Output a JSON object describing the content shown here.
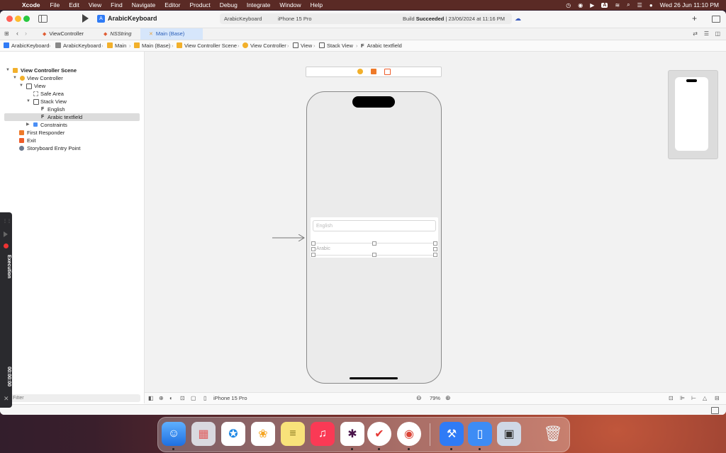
{
  "menubar": {
    "app_name": "Xcode",
    "items": [
      "File",
      "Edit",
      "View",
      "Find",
      "Navigate",
      "Editor",
      "Product",
      "Debug",
      "Integrate",
      "Window",
      "Help"
    ],
    "input_source": "A",
    "clock": "Wed 26 Jun  11:10 PM"
  },
  "toolbar": {
    "project_title": "ArabicKeyboard",
    "scheme": "ArabicKeyboard",
    "device": "iPhone 15 Pro",
    "build_prefix": "Build ",
    "build_status": "Succeeded",
    "build_time": " | 23/06/2024 at 11:16 PM"
  },
  "tabs": [
    {
      "label": "ViewController",
      "active": false
    },
    {
      "label": "NSString",
      "active": false
    },
    {
      "label": "Main (Base)",
      "active": true
    }
  ],
  "breadcrumb": [
    "ArabicKeyboard",
    "ArabicKeyboard",
    "Main",
    "Main (Base)",
    "View Controller Scene",
    "View Controller",
    "View",
    "Stack View",
    "Arabic textfield"
  ],
  "outline": {
    "rows": [
      {
        "label": "View Controller Scene"
      },
      {
        "label": "View Controller"
      },
      {
        "label": "View"
      },
      {
        "label": "Safe Area"
      },
      {
        "label": "Stack View"
      },
      {
        "label": "English"
      },
      {
        "label": "Arabic textfield"
      },
      {
        "label": "Constraints"
      },
      {
        "label": "First Responder"
      },
      {
        "label": "Exit"
      },
      {
        "label": "Storyboard Entry Point"
      }
    ],
    "selected_index": 6,
    "filter_placeholder": "Filter"
  },
  "canvas": {
    "english_placeholder": "English",
    "arabic_placeholder": "Arabic"
  },
  "canvas_bar": {
    "device": "iPhone 15 Pro",
    "zoom": "79%"
  },
  "exec_panel": {
    "label": "Execution",
    "time": "00:00:00"
  },
  "dock": {
    "apps": [
      "Finder",
      "Launchpad",
      "Safari",
      "Photos",
      "Notes",
      "Music",
      "Slack",
      "Tasks",
      "Chrome",
      "Xcode",
      "Simulator",
      "Preview",
      "Trash"
    ]
  },
  "colors": {
    "accent": "#2f7bf6",
    "tab_active_bg": "#d6e6fb",
    "selection": "#dcdcdc",
    "recording": "#e33333"
  }
}
